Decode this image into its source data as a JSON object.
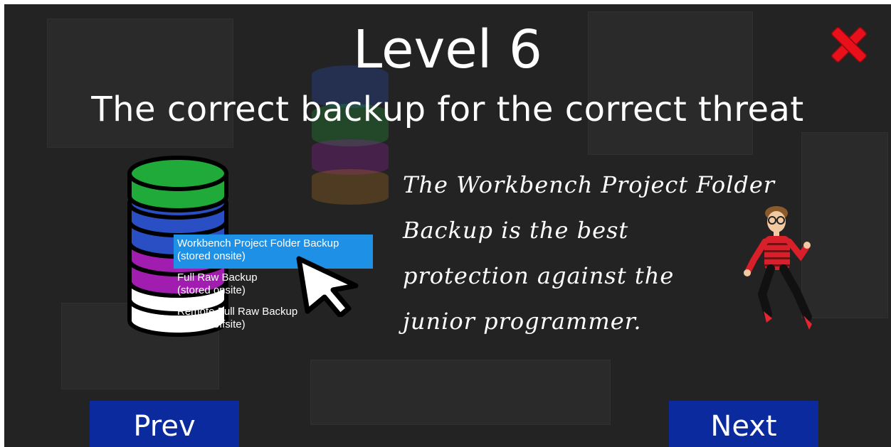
{
  "level": {
    "title": "Level 6",
    "subtitle": "The correct backup for the correct threat"
  },
  "backup_options": [
    {
      "name": "Workbench Project Folder Backup",
      "location": "(stored onsite)",
      "selected": true,
      "color": "#1e90e6"
    },
    {
      "name": "Full Raw Backup",
      "location": "(stored onsite)",
      "selected": false
    },
    {
      "name": "Remote Full Raw Backup",
      "location": "(stored offsite)",
      "selected": false
    }
  ],
  "description_lines": [
    "The Workbench Project Folder",
    "Backup is the best",
    "protection against the",
    "junior programmer."
  ],
  "stack_colors": [
    "#1faa3a",
    "#2a4fc4",
    "#a01db0",
    "#ffffff"
  ],
  "nav": {
    "prev_label": "Prev",
    "next_label": "Next",
    "button_color": "#0b2a9e"
  },
  "icons": {
    "close": "close-x-icon",
    "cursor": "pointer-cursor-icon"
  }
}
